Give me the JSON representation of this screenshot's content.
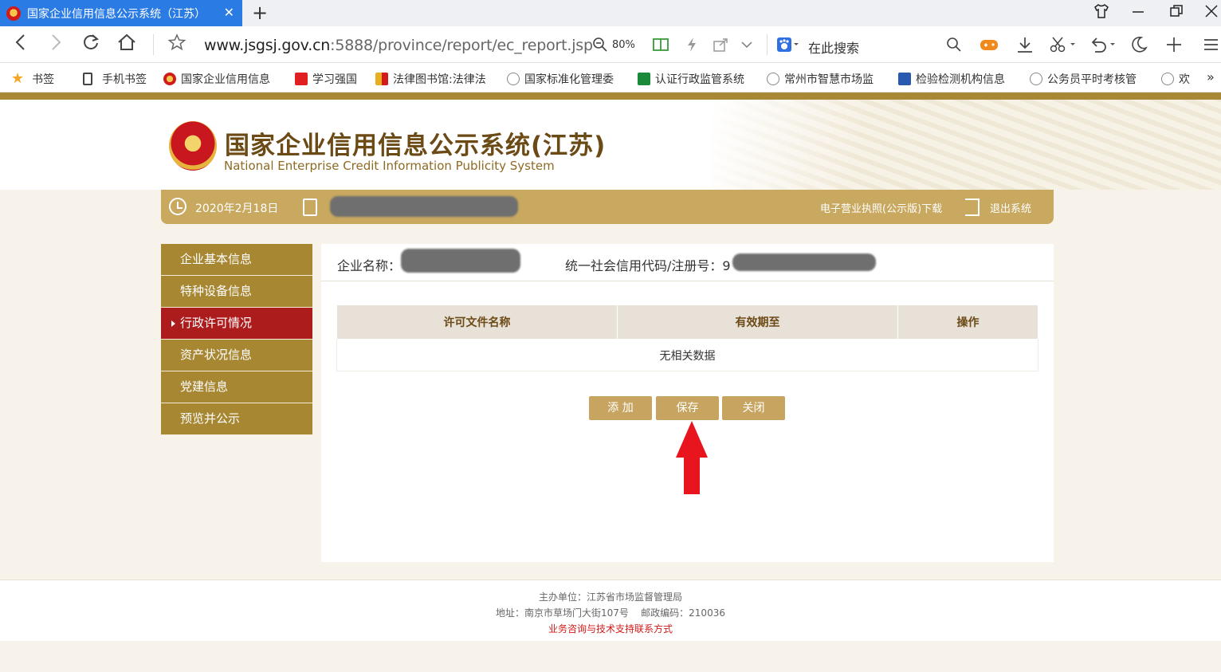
{
  "browser": {
    "tab_title": "国家企业信用信息公示系统（江苏）",
    "close_glyph": "✕",
    "new_tab_glyph": "+",
    "url_host": "www.jsgsj.gov.cn",
    "url_rest": ":5888/province/report/ec_report.jsp",
    "zoom": "80%",
    "search_placeholder": "在此搜索",
    "bookmarks": [
      {
        "label": "书签",
        "color": "#f5a623"
      },
      {
        "label": "手机书签",
        "color": "#cccccc"
      },
      {
        "label": "国家企业信用信息",
        "color": "#d21a1a"
      },
      {
        "label": "学习强国",
        "color": "#e02020"
      },
      {
        "label": "法律图书馆:法律法",
        "color": "#e8b020"
      },
      {
        "label": "国家标准化管理委",
        "color": "#888888"
      },
      {
        "label": "认证行政监管系统",
        "color": "#1a8a3a"
      },
      {
        "label": "常州市智慧市场监",
        "color": "#999999"
      },
      {
        "label": "检验检测机构信息",
        "color": "#2a5ab0"
      },
      {
        "label": "公务员平时考核管",
        "color": "#999999"
      },
      {
        "label": "欢",
        "color": "#999999"
      }
    ]
  },
  "site": {
    "title": "国家企业信用信息公示系统(江苏)",
    "subtitle": "National Enterprise Credit Information Publicity System",
    "date": "2020年2月18日",
    "download_label": "电子营业执照(公示版)下载",
    "exit_label": "退出系统"
  },
  "sidebar": {
    "items": [
      {
        "label": "企业基本信息",
        "active": false
      },
      {
        "label": "特种设备信息",
        "active": false
      },
      {
        "label": "行政许可情况",
        "active": true
      },
      {
        "label": "资产状况信息",
        "active": false
      },
      {
        "label": "党建信息",
        "active": false
      },
      {
        "label": "预览并公示",
        "active": false
      }
    ]
  },
  "main": {
    "company_label": "企业名称：",
    "credit_label": "统一社会信用代码/注册号：9",
    "table": {
      "headers": [
        "许可文件名称",
        "有效期至",
        "操作"
      ],
      "empty_text": "无相关数据"
    },
    "buttons": {
      "add": "添 加",
      "save": "保存",
      "close": "关闭"
    }
  },
  "footer": {
    "line1": "主办单位：江苏省市场监督管理局",
    "line2": "地址：南京市草场门大街107号    邮政编码：210036",
    "line3": "业务咨询与技术支持联系方式"
  },
  "colors": {
    "gold": "#a88733",
    "active_red": "#ad1c1c",
    "button": "#c7a45f",
    "arrow_red": "#e8141e"
  }
}
